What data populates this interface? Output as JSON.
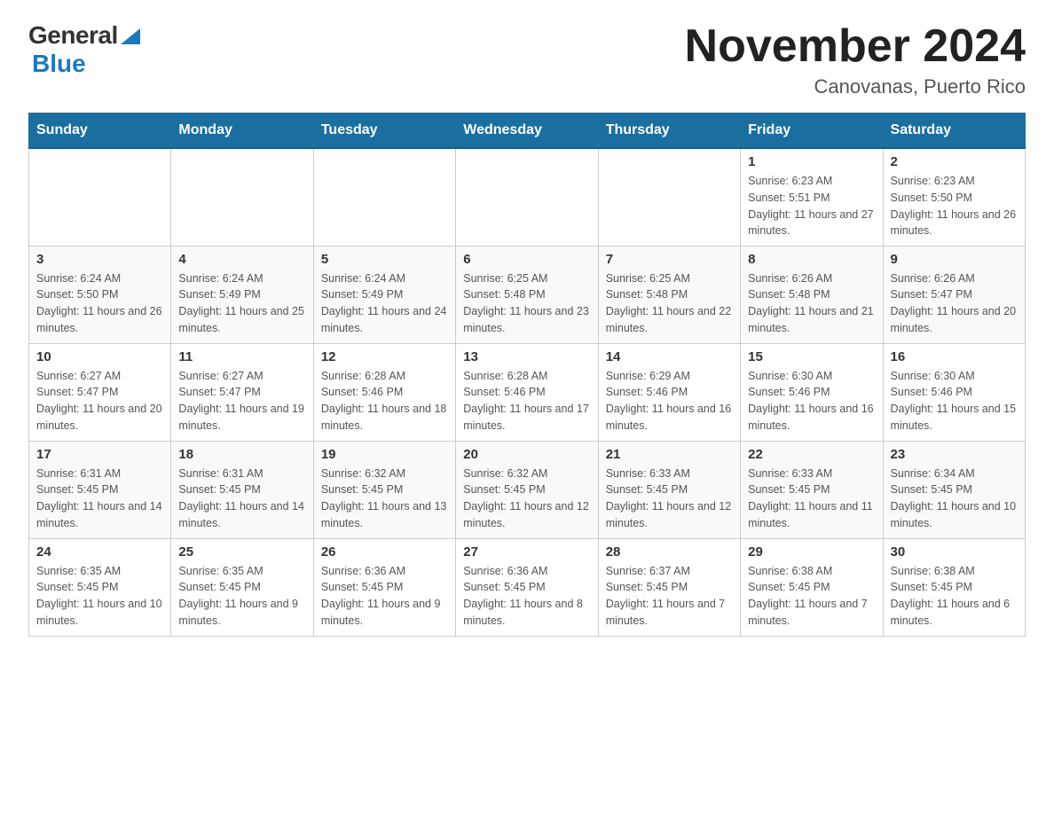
{
  "header": {
    "logo_general": "General",
    "logo_blue": "Blue",
    "title": "November 2024",
    "subtitle": "Canovanas, Puerto Rico"
  },
  "days_of_week": [
    "Sunday",
    "Monday",
    "Tuesday",
    "Wednesday",
    "Thursday",
    "Friday",
    "Saturday"
  ],
  "weeks": [
    [
      {
        "day": "",
        "info": ""
      },
      {
        "day": "",
        "info": ""
      },
      {
        "day": "",
        "info": ""
      },
      {
        "day": "",
        "info": ""
      },
      {
        "day": "",
        "info": ""
      },
      {
        "day": "1",
        "info": "Sunrise: 6:23 AM\nSunset: 5:51 PM\nDaylight: 11 hours and 27 minutes."
      },
      {
        "day": "2",
        "info": "Sunrise: 6:23 AM\nSunset: 5:50 PM\nDaylight: 11 hours and 26 minutes."
      }
    ],
    [
      {
        "day": "3",
        "info": "Sunrise: 6:24 AM\nSunset: 5:50 PM\nDaylight: 11 hours and 26 minutes."
      },
      {
        "day": "4",
        "info": "Sunrise: 6:24 AM\nSunset: 5:49 PM\nDaylight: 11 hours and 25 minutes."
      },
      {
        "day": "5",
        "info": "Sunrise: 6:24 AM\nSunset: 5:49 PM\nDaylight: 11 hours and 24 minutes."
      },
      {
        "day": "6",
        "info": "Sunrise: 6:25 AM\nSunset: 5:48 PM\nDaylight: 11 hours and 23 minutes."
      },
      {
        "day": "7",
        "info": "Sunrise: 6:25 AM\nSunset: 5:48 PM\nDaylight: 11 hours and 22 minutes."
      },
      {
        "day": "8",
        "info": "Sunrise: 6:26 AM\nSunset: 5:48 PM\nDaylight: 11 hours and 21 minutes."
      },
      {
        "day": "9",
        "info": "Sunrise: 6:26 AM\nSunset: 5:47 PM\nDaylight: 11 hours and 20 minutes."
      }
    ],
    [
      {
        "day": "10",
        "info": "Sunrise: 6:27 AM\nSunset: 5:47 PM\nDaylight: 11 hours and 20 minutes."
      },
      {
        "day": "11",
        "info": "Sunrise: 6:27 AM\nSunset: 5:47 PM\nDaylight: 11 hours and 19 minutes."
      },
      {
        "day": "12",
        "info": "Sunrise: 6:28 AM\nSunset: 5:46 PM\nDaylight: 11 hours and 18 minutes."
      },
      {
        "day": "13",
        "info": "Sunrise: 6:28 AM\nSunset: 5:46 PM\nDaylight: 11 hours and 17 minutes."
      },
      {
        "day": "14",
        "info": "Sunrise: 6:29 AM\nSunset: 5:46 PM\nDaylight: 11 hours and 16 minutes."
      },
      {
        "day": "15",
        "info": "Sunrise: 6:30 AM\nSunset: 5:46 PM\nDaylight: 11 hours and 16 minutes."
      },
      {
        "day": "16",
        "info": "Sunrise: 6:30 AM\nSunset: 5:46 PM\nDaylight: 11 hours and 15 minutes."
      }
    ],
    [
      {
        "day": "17",
        "info": "Sunrise: 6:31 AM\nSunset: 5:45 PM\nDaylight: 11 hours and 14 minutes."
      },
      {
        "day": "18",
        "info": "Sunrise: 6:31 AM\nSunset: 5:45 PM\nDaylight: 11 hours and 14 minutes."
      },
      {
        "day": "19",
        "info": "Sunrise: 6:32 AM\nSunset: 5:45 PM\nDaylight: 11 hours and 13 minutes."
      },
      {
        "day": "20",
        "info": "Sunrise: 6:32 AM\nSunset: 5:45 PM\nDaylight: 11 hours and 12 minutes."
      },
      {
        "day": "21",
        "info": "Sunrise: 6:33 AM\nSunset: 5:45 PM\nDaylight: 11 hours and 12 minutes."
      },
      {
        "day": "22",
        "info": "Sunrise: 6:33 AM\nSunset: 5:45 PM\nDaylight: 11 hours and 11 minutes."
      },
      {
        "day": "23",
        "info": "Sunrise: 6:34 AM\nSunset: 5:45 PM\nDaylight: 11 hours and 10 minutes."
      }
    ],
    [
      {
        "day": "24",
        "info": "Sunrise: 6:35 AM\nSunset: 5:45 PM\nDaylight: 11 hours and 10 minutes."
      },
      {
        "day": "25",
        "info": "Sunrise: 6:35 AM\nSunset: 5:45 PM\nDaylight: 11 hours and 9 minutes."
      },
      {
        "day": "26",
        "info": "Sunrise: 6:36 AM\nSunset: 5:45 PM\nDaylight: 11 hours and 9 minutes."
      },
      {
        "day": "27",
        "info": "Sunrise: 6:36 AM\nSunset: 5:45 PM\nDaylight: 11 hours and 8 minutes."
      },
      {
        "day": "28",
        "info": "Sunrise: 6:37 AM\nSunset: 5:45 PM\nDaylight: 11 hours and 7 minutes."
      },
      {
        "day": "29",
        "info": "Sunrise: 6:38 AM\nSunset: 5:45 PM\nDaylight: 11 hours and 7 minutes."
      },
      {
        "day": "30",
        "info": "Sunrise: 6:38 AM\nSunset: 5:45 PM\nDaylight: 11 hours and 6 minutes."
      }
    ]
  ]
}
